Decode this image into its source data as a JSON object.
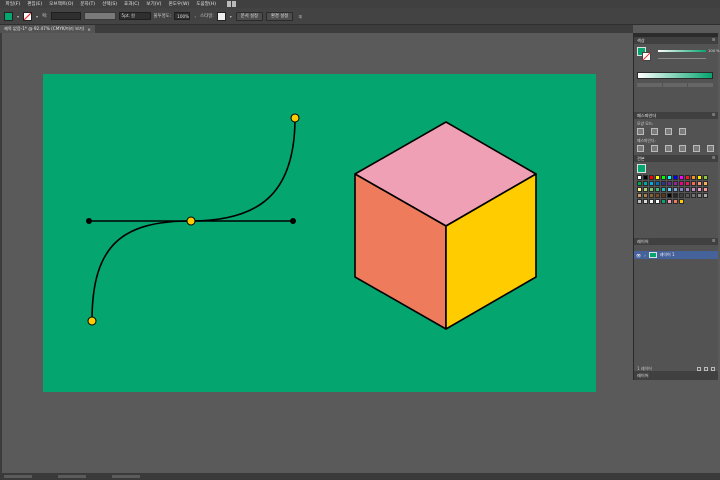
{
  "menubar": {
    "items": [
      "파일(F)",
      "편집(E)",
      "오브젝트(O)",
      "문자(T)",
      "선택(S)",
      "효과(C)",
      "보기(V)",
      "윈도우(W)",
      "도움말(H)"
    ],
    "arrange_icon": "arrange-documents-icon"
  },
  "controlbar": {
    "fill_color": "#05a570",
    "stroke_label": "획:",
    "stroke_style": "5pt. 원",
    "opacity_label": "불투명도:",
    "opacity_value": "100%",
    "style_label": "스타일:",
    "doc_setup_button": "문서 설정",
    "preferences_button": "환경 설정"
  },
  "document_tab": {
    "title": "제목 없음-1* @ 92.47% (CMYK/미리 보기)",
    "close": "×"
  },
  "artboard": {
    "background": "#05a570",
    "cube_colors": {
      "top": "#f0a0b4",
      "left": "#ee7c5c",
      "right": "#ffcc00"
    },
    "anchor_color": "#ffcc00"
  },
  "panels": {
    "color": {
      "title": "색상",
      "slider_value": "100",
      "slider_unit": "%"
    },
    "pathfinder": {
      "title": "패스파인더",
      "shape_modes_label": "모양 모드:",
      "pathfinders_label": "패스파인더:"
    },
    "swatches": {
      "title": "견본",
      "colors": [
        "#ffffff",
        "#000000",
        "#ff0000",
        "#ffff00",
        "#00ff00",
        "#00ffff",
        "#0000ff",
        "#ff00ff",
        "#ee1c24",
        "#f7941d",
        "#fff200",
        "#8dc63f",
        "#00a651",
        "#00a99d",
        "#00aeef",
        "#0072bc",
        "#2e3192",
        "#662d91",
        "#92278f",
        "#ec008c",
        "#ed145b",
        "#f26c4f",
        "#f69679",
        "#fbaf5d",
        "#fff799",
        "#acd373",
        "#7cc576",
        "#3bb878",
        "#1abbb4",
        "#6dcff6",
        "#7da7d9",
        "#8781bd",
        "#a186be",
        "#bd8cbf",
        "#f49ac1",
        "#f5989d",
        "#c69c6d",
        "#a67c52",
        "#8c6239",
        "#754c24",
        "#603913",
        "#000000",
        "#262626",
        "#404040",
        "#595959",
        "#737373",
        "#8c8c8c",
        "#a6a6a6",
        "#c0c0c0",
        "#d9d9d9",
        "#f2f2f2",
        "#ffffff",
        "#05a570",
        "#f0a0b4",
        "#ee7c5c",
        "#ffcc00"
      ]
    },
    "layers": {
      "title": "레이어",
      "layer_name": "레이어 1",
      "footer_count": "1 레이어"
    }
  }
}
